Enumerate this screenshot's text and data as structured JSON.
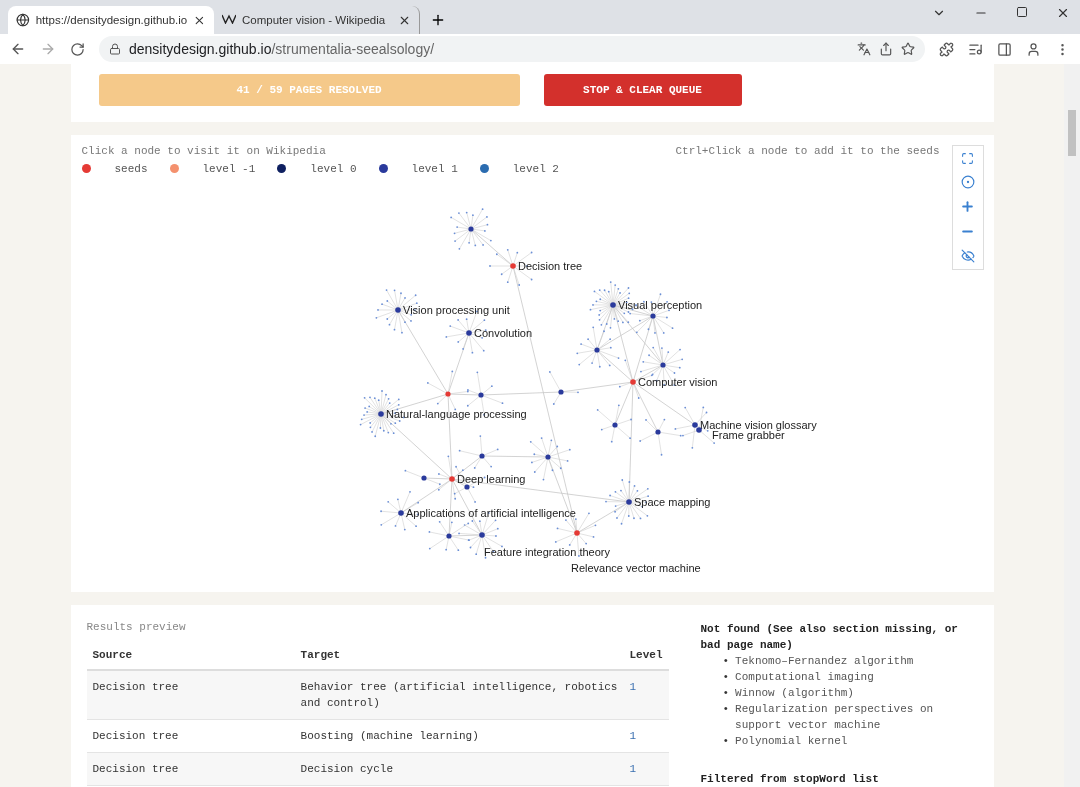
{
  "browser": {
    "tabs": [
      {
        "title": "https://densitydesign.github.io",
        "selected": true,
        "kind": "globe"
      },
      {
        "title": "Computer vision - Wikipedia",
        "selected": false,
        "kind": "wiki"
      }
    ],
    "address": {
      "host": "densitydesign.github.io",
      "path": "/strumentalia-seealsology/"
    }
  },
  "controls": {
    "progress": "41 / 59 PAGES RESOLVED",
    "stop_button": "STOP & CLEAR QUEUE"
  },
  "graph": {
    "hint_left": "Click a node to visit it on Wikipedia",
    "hint_right": "Ctrl+Click a node to add it to the seeds",
    "legend": [
      {
        "label": "seeds",
        "color": "#e53a35"
      },
      {
        "label": "level -1",
        "color": "#f4916e"
      },
      {
        "label": "level 0",
        "color": "#0f2060"
      },
      {
        "label": "level 1",
        "color": "#2a3a9c"
      },
      {
        "label": "level 2",
        "color": "#2b6cb0"
      }
    ],
    "nodes": [
      {
        "label": "Decision tree",
        "color": "#e53a35"
      },
      {
        "label": "Vision processing unit",
        "color": "#2a3a9c"
      },
      {
        "label": "Convolution",
        "color": "#2a3a9c"
      },
      {
        "label": "Visual perception",
        "color": "#2a3a9c"
      },
      {
        "label": "Computer vision",
        "color": "#e53a35"
      },
      {
        "label": "Natural-language processing",
        "color": "#2a3a9c"
      },
      {
        "label": "Machine vision glossary",
        "color": "#2a3a9c"
      },
      {
        "label": "Frame grabber",
        "color": "#2a3a9c"
      },
      {
        "label": "Deep learning",
        "color": "#e53a35"
      },
      {
        "label": "Space mapping",
        "color": "#2a3a9c"
      },
      {
        "label": "Applications of artificial intelligence",
        "color": "#2a3a9c"
      },
      {
        "label": "Feature integration theory",
        "color": "#2a3a9c"
      },
      {
        "label": "Relevance vector machine",
        "color": "#e53a35"
      }
    ]
  },
  "results": {
    "title": "Results preview",
    "columns": [
      "Source",
      "Target",
      "Level"
    ],
    "rows": [
      [
        "Decision tree",
        "Behavior tree (artificial intelligence, robotics and control)",
        "1"
      ],
      [
        "Decision tree",
        "Boosting (machine learning)",
        "1"
      ],
      [
        "Decision tree",
        "Decision cycle",
        "1"
      ]
    ]
  },
  "not_found": {
    "title": "Not found (See also section missing, or bad page name)",
    "items": [
      {
        "marker": "•",
        "text": "Teknomo–Fernandez algorithm"
      },
      {
        "marker": "•",
        "text": "Computational imaging"
      },
      {
        "marker": "•",
        "text": "Winnow (algorithm)"
      },
      {
        "marker": "•",
        "text": "Regularization perspectives on support vector machine"
      },
      {
        "marker": "•",
        "text": "Polynomial kernel"
      }
    ]
  },
  "filtered_title": "Filtered from stopWord list"
}
